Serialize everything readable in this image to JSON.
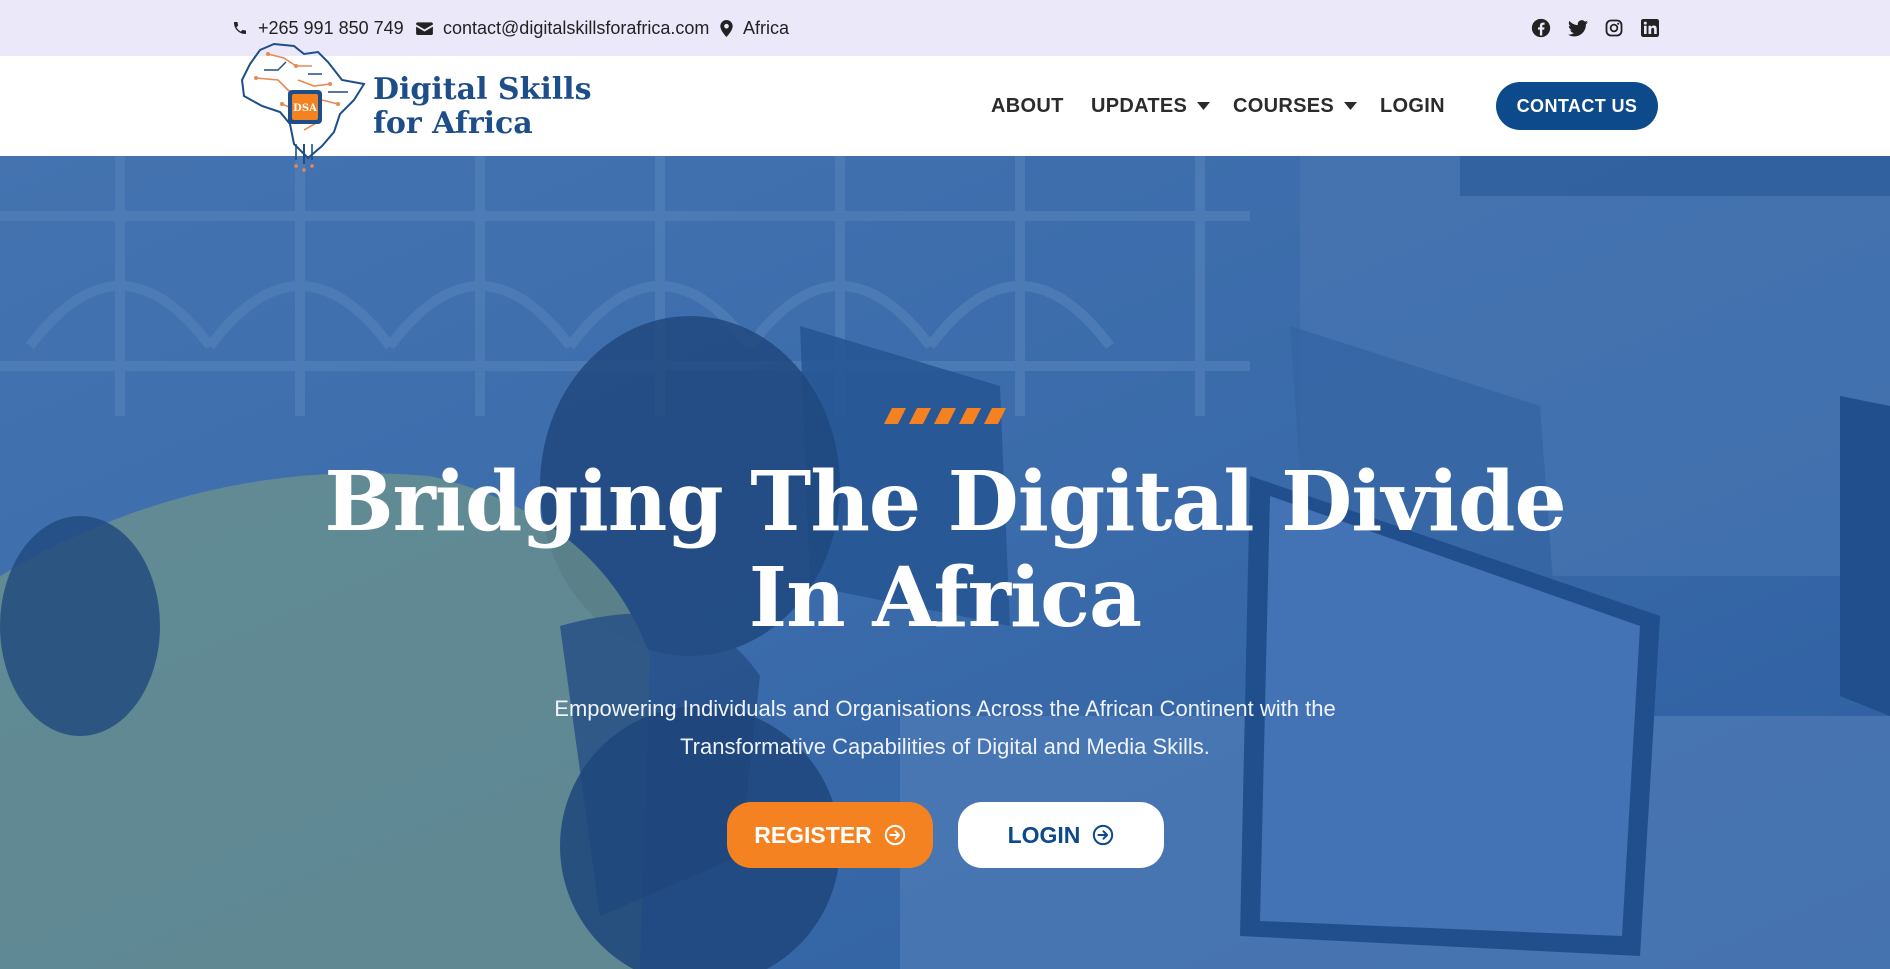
{
  "topbar": {
    "phone": "+265 991 850 749",
    "email": "contact@digitalskillsforafrica.com",
    "location": "Africa",
    "icons": [
      "phone-icon",
      "envelope-icon",
      "map-marker-icon",
      "facebook-icon",
      "twitter-icon",
      "instagram-icon",
      "linkedin-icon"
    ]
  },
  "logo": {
    "badge": "DSA",
    "line1": "Digital Skills",
    "line2": "for Africa"
  },
  "nav": {
    "about": "ABOUT",
    "updates": "UPDATES",
    "courses": "COURSES",
    "login": "LOGIN",
    "contact": "CONTACT US"
  },
  "hero": {
    "title_line1": "Bridging The Digital Divide",
    "title_line2": "In Africa",
    "subtitle_line1": "Empowering Individuals and Organisations Across the African Continent with the",
    "subtitle_line2": "Transformative Capabilities of Digital and Media Skills.",
    "register_label": "REGISTER",
    "login_label": "LOGIN"
  },
  "colors": {
    "brand_blue": "#0d4a8c",
    "logo_blue": "#1d4e89",
    "accent_orange": "#f58220",
    "topbar_bg": "#ebe9f9",
    "hero_overlay": "#205caa"
  }
}
